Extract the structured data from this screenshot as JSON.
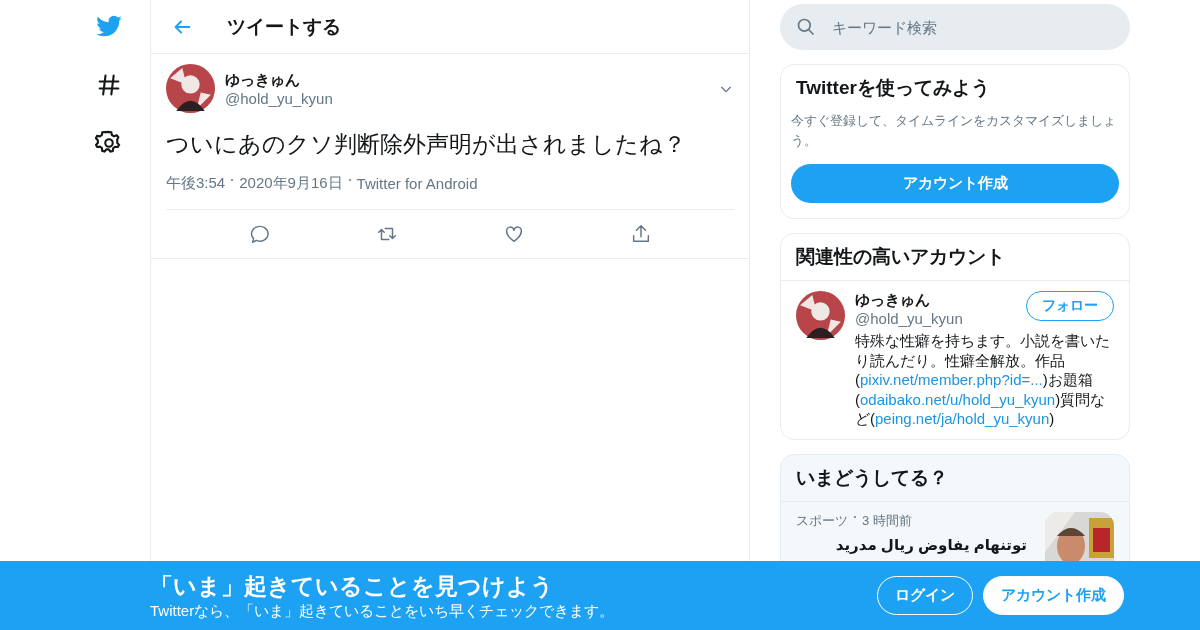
{
  "header": {
    "title": "ツイートする"
  },
  "tweet": {
    "name": "ゆっきゅん",
    "handle": "@hold_yu_kyun",
    "text": "ついにあのクソ判断除外声明が出されましたね？",
    "meta": [
      "午後3:54",
      "2020年9月16日",
      "Twitter for Android"
    ]
  },
  "search": {
    "placeholder": "キーワード検索"
  },
  "signup_card": {
    "title": "Twitterを使ってみよう",
    "description": "今すぐ登録して、タイムラインをカスタマイズしましょう。",
    "button": "アカウント作成"
  },
  "related": {
    "title": "関連性の高いアカウント",
    "account": {
      "name": "ゆっきゅん",
      "handle": "@hold_yu_kyun",
      "follow_button": "フォロー",
      "bio": [
        {
          "kind": "text",
          "text": "特殊な性癖を持ちます。小説を書いたり読んだり。性癖全解放。作品("
        },
        {
          "kind": "link",
          "text": "pixiv.net/member.php?id=..."
        },
        {
          "kind": "text",
          "text": ")お題箱("
        },
        {
          "kind": "link",
          "text": "odaibako.net/u/hold_yu_kyun"
        },
        {
          "kind": "text",
          "text": ")質問など("
        },
        {
          "kind": "link",
          "text": "peing.net/ja/hold_yu_kyun"
        },
        {
          "kind": "text",
          "text": ")"
        }
      ]
    }
  },
  "trends": {
    "title": "いまどうしてる？",
    "items": [
      {
        "category": "スポーツ",
        "time": "3 時間前",
        "headline": "توتنهام يفاوض ريال مدريد",
        "kind": "picture"
      }
    ]
  },
  "banner": {
    "title": "「いま」起きていることを見つけよう",
    "subtitle": "Twitterなら、「いま」起きていることをいち早くチェックできます。",
    "buttons": [
      {
        "label": "ログイン",
        "kind": "outline"
      },
      {
        "label": "アカウント作成",
        "kind": "filled"
      }
    ]
  }
}
